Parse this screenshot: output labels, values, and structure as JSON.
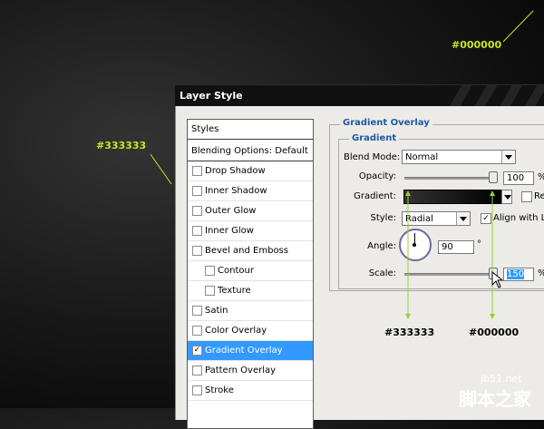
{
  "annotations": {
    "top_right_color": "#000000",
    "left_color": "#333333",
    "bottom_callout_left": "#333333",
    "bottom_callout_right": "#000000",
    "accent_color": "#c8e61e"
  },
  "dialog": {
    "title": "Layer Style",
    "styles_list": {
      "header": "Styles",
      "blending": "Blending Options: Default",
      "items": [
        {
          "label": "Drop Shadow",
          "checked": false
        },
        {
          "label": "Inner Shadow",
          "checked": false
        },
        {
          "label": "Outer Glow",
          "checked": false
        },
        {
          "label": "Inner Glow",
          "checked": false
        },
        {
          "label": "Bevel and Emboss",
          "checked": false
        },
        {
          "label": "Contour",
          "checked": false
        },
        {
          "label": "Texture",
          "checked": false
        },
        {
          "label": "Satin",
          "checked": false
        },
        {
          "label": "Color Overlay",
          "checked": false
        },
        {
          "label": "Gradient Overlay",
          "checked": true
        },
        {
          "label": "Pattern Overlay",
          "checked": false
        },
        {
          "label": "Stroke",
          "checked": false
        }
      ],
      "selected_color": "#3399ff"
    },
    "panel": {
      "title": "Gradient Overlay",
      "group_title": "Gradient",
      "blend_mode_label": "Blend Mode:",
      "blend_mode_value": "Normal",
      "opacity_label": "Opacity:",
      "opacity_value": "100",
      "opacity_unit": "%",
      "gradient_label": "Gradient:",
      "gradient_start": "#333333",
      "gradient_end": "#000000",
      "reverse_label": "Re",
      "style_label": "Style:",
      "style_value": "Radial",
      "align_label": "Align with La",
      "align_checked": true,
      "angle_label": "Angle:",
      "angle_value": "90",
      "angle_unit": "°",
      "scale_label": "Scale:",
      "scale_value": "150",
      "scale_unit": "%"
    }
  },
  "watermark": {
    "site": "jb51.net",
    "name": "脚本之家"
  },
  "icons": [
    "checkbox-icon",
    "dropdown-arrow-icon",
    "angle-dial-icon",
    "mouse-cursor-icon"
  ]
}
